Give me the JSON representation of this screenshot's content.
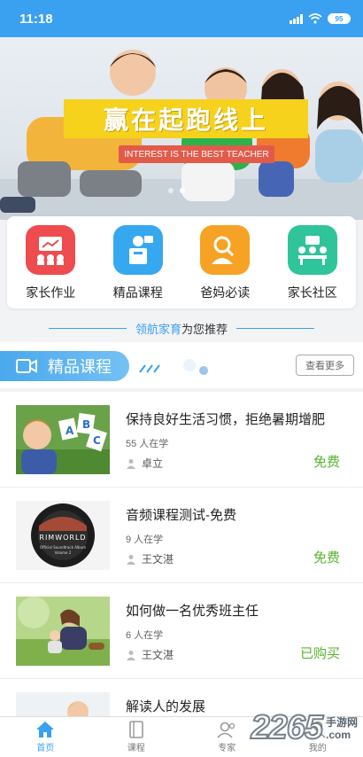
{
  "status": {
    "time": "11:18",
    "battery": "95"
  },
  "banner": {
    "title": "赢在起跑线上",
    "subtitle": "INTEREST IS THE BEST TEACHER"
  },
  "quick_menu": [
    {
      "label": "家长作业",
      "icon": "homework-icon",
      "color": "#ee4c4f"
    },
    {
      "label": "精品课程",
      "icon": "lecture-icon",
      "color": "#36a8ef"
    },
    {
      "label": "爸妈必读",
      "icon": "reading-icon",
      "color": "#f6a224"
    },
    {
      "label": "家长社区",
      "icon": "community-icon",
      "color": "#2fc49a"
    }
  ],
  "recommend": {
    "brand": "领航家育",
    "suffix": "为您推荐"
  },
  "section": {
    "title": "精品课程",
    "more": "查看更多",
    "icon": "video-icon"
  },
  "courses": [
    {
      "title": "保持良好生活习惯，拒绝暑期增肥",
      "count": "55 人在学",
      "teacher": "卓立",
      "price": "免费"
    },
    {
      "title": "音频课程测试-免费",
      "count": "9 人在学",
      "teacher": "王文湛",
      "price": "免费",
      "thumb_text": "RIMWORLD",
      "thumb_sub": "Official Soundtrack Album",
      "thumb_vol": "Volume 2"
    },
    {
      "title": "如何做一名优秀班主任",
      "count": "6 人在学",
      "teacher": "王文湛",
      "price": "已购买"
    },
    {
      "title": "解读人的发展",
      "count": "",
      "teacher": "",
      "price": ""
    }
  ],
  "bottom_nav": [
    {
      "label": "首页",
      "icon": "home-icon",
      "active": true
    },
    {
      "label": "课程",
      "icon": "book-icon",
      "active": false
    },
    {
      "label": "专家",
      "icon": "expert-icon",
      "active": false
    },
    {
      "label": "我的",
      "icon": "user-icon",
      "active": false
    }
  ],
  "watermark": {
    "number": "2265",
    "line1": "手游网",
    "line2": ".com"
  },
  "colors": {
    "primary": "#3aa0f0",
    "price_green": "#55b52e",
    "banner_yellow": "#f6d21c",
    "banner_red": "#e25b4a"
  }
}
